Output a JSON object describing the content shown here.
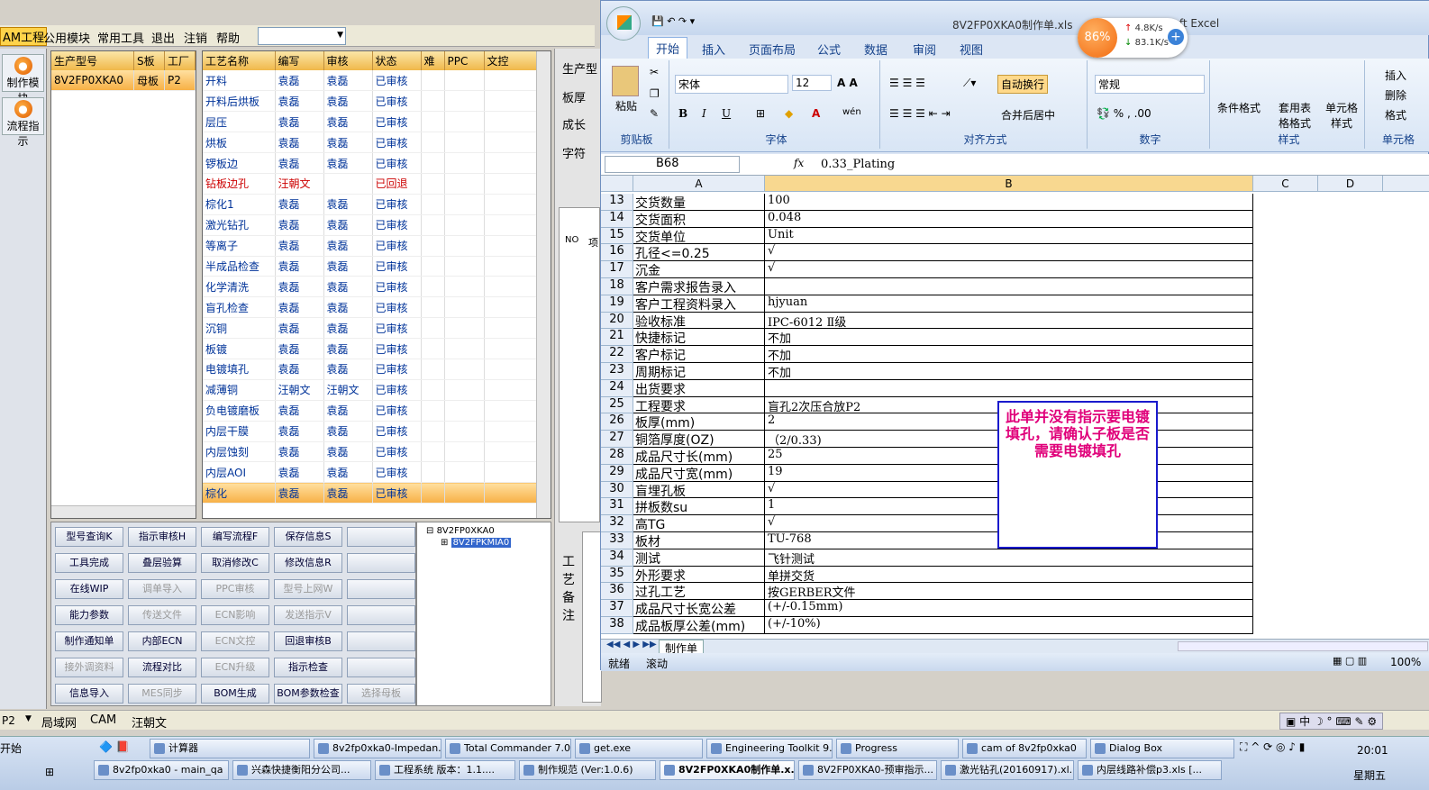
{
  "cam": {
    "menu": [
      "AM工程",
      "公用模块",
      "常用工具",
      "退出",
      "注销",
      "帮助"
    ],
    "left_buttons": [
      "制作模块",
      "流程指示"
    ],
    "model_grid": {
      "headers": [
        "生产型号",
        "S板",
        "工厂"
      ],
      "row": [
        "8V2FP0XKA0",
        "母板",
        "P2"
      ]
    },
    "process_grid": {
      "headers": [
        "工艺名称",
        "编写",
        "审核",
        "状态",
        "难",
        "PPC",
        "文控"
      ],
      "rows": [
        [
          "开料",
          "袁磊",
          "袁磊",
          "已审核"
        ],
        [
          "开料后烘板",
          "袁磊",
          "袁磊",
          "已审核"
        ],
        [
          "层压",
          "袁磊",
          "袁磊",
          "已审核"
        ],
        [
          "烘板",
          "袁磊",
          "袁磊",
          "已审核"
        ],
        [
          "锣板边",
          "袁磊",
          "袁磊",
          "已审核"
        ],
        [
          "钻板边孔",
          "汪朝文",
          "",
          "已回退"
        ],
        [
          "棕化1",
          "袁磊",
          "袁磊",
          "已审核"
        ],
        [
          "激光钻孔",
          "袁磊",
          "袁磊",
          "已审核"
        ],
        [
          "等离子",
          "袁磊",
          "袁磊",
          "已审核"
        ],
        [
          "半成品检查",
          "袁磊",
          "袁磊",
          "已审核"
        ],
        [
          "化学清洗",
          "袁磊",
          "袁磊",
          "已审核"
        ],
        [
          "盲孔检查",
          "袁磊",
          "袁磊",
          "已审核"
        ],
        [
          "沉铜",
          "袁磊",
          "袁磊",
          "已审核"
        ],
        [
          "板镀",
          "袁磊",
          "袁磊",
          "已审核"
        ],
        [
          "电镀填孔",
          "袁磊",
          "袁磊",
          "已审核"
        ],
        [
          "减薄铜",
          "汪朝文",
          "汪朝文",
          "已审核"
        ],
        [
          "负电镀磨板",
          "袁磊",
          "袁磊",
          "已审核"
        ],
        [
          "内层干膜",
          "袁磊",
          "袁磊",
          "已审核"
        ],
        [
          "内层蚀刻",
          "袁磊",
          "袁磊",
          "已审核"
        ],
        [
          "内层AOI",
          "袁磊",
          "袁磊",
          "已审核"
        ],
        [
          "棕化",
          "袁磊",
          "袁磊",
          "已审核"
        ]
      ]
    },
    "side_labels": [
      "生产型",
      "板厚",
      "成长",
      "字符"
    ],
    "mid_header": [
      "NO",
      "项"
    ],
    "mid_label": "工艺备注",
    "buttons": [
      [
        "型号查询K",
        "指示审核H",
        "编写流程F",
        "保存信息S",
        ""
      ],
      [
        "工具完成",
        "叠层验算",
        "取消修改C",
        "修改信息R",
        ""
      ],
      [
        "在线WIP",
        "调单导入",
        "PPC审核",
        "型号上网W",
        ""
      ],
      [
        "能力参数",
        "传送文件",
        "ECN影响",
        "发送指示V",
        ""
      ],
      [
        "制作通知单",
        "内部ECN",
        "ECN文控",
        "回退审核B",
        ""
      ],
      [
        "接外调资料",
        "流程对比",
        "ECN升级",
        "指示检查",
        ""
      ],
      [
        "信息导入",
        "MES同步",
        "BOM生成",
        "BOM参数检查",
        "选择母板"
      ]
    ],
    "tree": [
      "8V2FP0XKA0",
      "8V2FPKMIA0"
    ]
  },
  "excel": {
    "title": "8V2FP0XKA0制作单.xls",
    "app": "Microsoft Excel",
    "tabs": [
      "开始",
      "插入",
      "页面布局",
      "公式",
      "数据",
      "审阅",
      "视图"
    ],
    "groups": [
      "剪贴板",
      "字体",
      "对齐方式",
      "数字",
      "样式",
      "单元格"
    ],
    "paste": "粘贴",
    "font_name": "宋体",
    "font_size": "12",
    "wrap": "自动换行",
    "merge": "合并后居中",
    "number_format": "常规",
    "styles": [
      "条件格式",
      "套用表格格式",
      "单元格样式"
    ],
    "cells_btns": [
      "插入",
      "删除",
      "格式"
    ],
    "cell_ref": "B68",
    "formula": "0.33_Plating",
    "columns": [
      "A",
      "B",
      "C",
      "D"
    ],
    "rows": [
      [
        "13",
        "交货数量",
        "100"
      ],
      [
        "14",
        "交货面积",
        "0.048"
      ],
      [
        "15",
        "交货单位",
        "Unit"
      ],
      [
        "16",
        "孔径<=0.25",
        "√"
      ],
      [
        "17",
        "沉金",
        "√"
      ],
      [
        "18",
        "客户需求报告录入",
        ""
      ],
      [
        "19",
        "客户工程资料录入",
        "hjyuan"
      ],
      [
        "20",
        "验收标准",
        "IPC-6012 Ⅱ级"
      ],
      [
        "21",
        "快捷标记",
        "不加"
      ],
      [
        "22",
        "客户标记",
        "不加"
      ],
      [
        "23",
        "周期标记",
        "不加"
      ],
      [
        "24",
        "出货要求",
        ""
      ],
      [
        "25",
        "工程要求",
        "盲孔2次压合放P2"
      ],
      [
        "26",
        "板厚(mm)",
        "2"
      ],
      [
        "27",
        "铜箔厚度(OZ)",
        "（2/0.33)"
      ],
      [
        "28",
        "成品尺寸长(mm)",
        "25"
      ],
      [
        "29",
        "成品尺寸宽(mm)",
        "19"
      ],
      [
        "30",
        "盲埋孔板",
        "√"
      ],
      [
        "31",
        "拼板数su",
        "1"
      ],
      [
        "32",
        "高TG",
        "√"
      ],
      [
        "33",
        "板材",
        "TU-768"
      ],
      [
        "34",
        "测试",
        "飞针测试"
      ],
      [
        "35",
        "外形要求",
        "单拼交货"
      ],
      [
        "36",
        "过孔工艺",
        "按GERBER文件"
      ],
      [
        "37",
        "成品尺寸长宽公差",
        "(+/-0.15mm)"
      ],
      [
        "38",
        "成品板厚公差(mm)",
        "(+/-10%)"
      ]
    ],
    "note": "此单并没有指示要电镀填孔，请确认子板是否需要电镀填孔",
    "sheet_tab": "制作单",
    "status": [
      "就绪",
      "滚动"
    ],
    "zoom": "100%"
  },
  "speed": {
    "percent": "86%",
    "up": "4.8K/s",
    "down": "83.1K/s"
  },
  "statusbar": [
    "P2",
    "局域网",
    "CAM",
    "汪朝文"
  ],
  "taskbar": {
    "start": "开始",
    "row1": [
      "计算器",
      "8v2fp0xka0-Impedan...",
      "Total Commander 7.0...",
      "get.exe",
      "Engineering Toolkit 9....",
      "Progress",
      "cam of 8v2fp0xka0",
      "Dialog Box"
    ],
    "row2": [
      "8v2fp0xka0 - main_qa",
      "兴森快捷衡阳分公司...",
      "工程系统 版本：1.1....",
      "制作规范 (Ver:1.0.6)",
      "8V2FP0XKA0制作单.x...",
      "8V2FP0XKA0-预审指示...",
      "激光钻孔(20160917).xl...",
      "内层线路补偿p3.xls [..."
    ],
    "ime": "中",
    "time": "20:01",
    "day": "星期五"
  }
}
